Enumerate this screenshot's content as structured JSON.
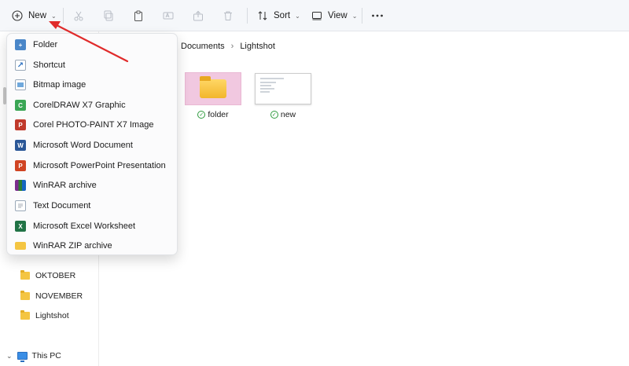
{
  "toolbar": {
    "new_label": "New",
    "sort_label": "Sort",
    "view_label": "View"
  },
  "breadcrumb": [
    "Documents",
    "Lightshot"
  ],
  "items": [
    {
      "label": "folder"
    },
    {
      "label": "new"
    }
  ],
  "new_menu": {
    "items": [
      {
        "label": "Folder",
        "icon": "new-folder-icon"
      },
      {
        "label": "Shortcut",
        "icon": "shortcut-icon"
      },
      {
        "label": "Bitmap image",
        "icon": "bitmap-icon"
      },
      {
        "label": "CorelDRAW X7 Graphic",
        "icon": "coreldraw-icon"
      },
      {
        "label": "Corel PHOTO-PAINT X7 Image",
        "icon": "photopaint-icon"
      },
      {
        "label": "Microsoft Word Document",
        "icon": "word-icon"
      },
      {
        "label": "Microsoft PowerPoint Presentation",
        "icon": "powerpoint-icon"
      },
      {
        "label": "WinRAR archive",
        "icon": "winrar-icon"
      },
      {
        "label": "Text Document",
        "icon": "text-document-icon"
      },
      {
        "label": "Microsoft Excel Worksheet",
        "icon": "excel-icon"
      },
      {
        "label": "WinRAR ZIP archive",
        "icon": "zip-icon"
      }
    ]
  },
  "sidebar": {
    "items": [
      {
        "label": "OKTOBER"
      },
      {
        "label": "NOVEMBER"
      },
      {
        "label": "Lightshot"
      }
    ],
    "this_pc": "This PC"
  },
  "colors": {
    "accent": "#0067c0",
    "arrow": "#e02b2b",
    "selection": "#f1c8e0"
  }
}
